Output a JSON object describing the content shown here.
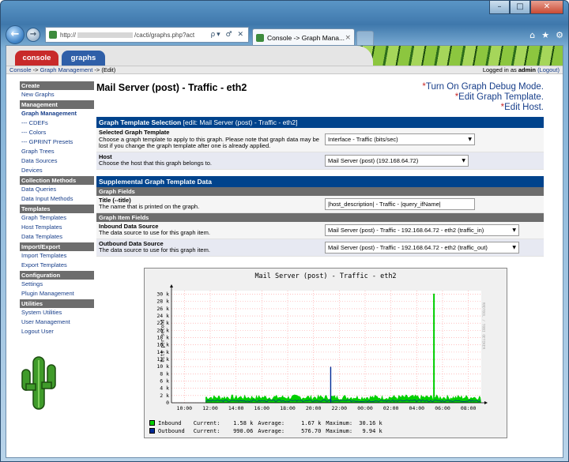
{
  "window": {
    "controls": [
      "–",
      "□",
      "✕"
    ]
  },
  "browser": {
    "address_prefix": "http://",
    "address_suffix": "/cacti/graphs.php?act",
    "address_tools": "ρ▾ ♂ ✕",
    "tab_title": "Console -> Graph Mana...",
    "tab_close": "×",
    "icons": [
      "⌂",
      "★",
      "⚙"
    ]
  },
  "header": {
    "tabs": {
      "console": "console",
      "graphs": "graphs"
    }
  },
  "breadcrumb": {
    "console": "Console",
    "sep1": " -> ",
    "graph_management": "Graph Management",
    "sep2": " -> ",
    "current": "(Edit)",
    "login_prefix": "Logged in as ",
    "user": "admin",
    "logout": "(Logout)"
  },
  "sidebar": {
    "sections": [
      {
        "head": "Create",
        "items": [
          {
            "label": "New Graphs"
          }
        ]
      },
      {
        "head": "Management",
        "items": [
          {
            "label": "Graph Management",
            "active": true
          },
          {
            "label": "--- CDEFs"
          },
          {
            "label": "--- Colors"
          },
          {
            "label": "--- GPRINT Presets"
          },
          {
            "label": "Graph Trees"
          },
          {
            "label": "Data Sources"
          },
          {
            "label": "Devices"
          }
        ]
      },
      {
        "head": "Collection Methods",
        "items": [
          {
            "label": "Data Queries"
          },
          {
            "label": "Data Input Methods"
          }
        ]
      },
      {
        "head": "Templates",
        "items": [
          {
            "label": "Graph Templates"
          },
          {
            "label": "Host Templates"
          },
          {
            "label": "Data Templates"
          }
        ]
      },
      {
        "head": "Import/Export",
        "items": [
          {
            "label": "Import Templates"
          },
          {
            "label": "Export Templates"
          }
        ]
      },
      {
        "head": "Configuration",
        "items": [
          {
            "label": "Settings"
          },
          {
            "label": "Plugin Management"
          }
        ]
      },
      {
        "head": "Utilities",
        "items": [
          {
            "label": "System Utilities"
          },
          {
            "label": "User Management"
          },
          {
            "label": "Logout User"
          }
        ]
      }
    ]
  },
  "main": {
    "title": "Mail Server (post) - Traffic - eth2",
    "actions": {
      "star": "*",
      "debug": "Turn On Graph Debug Mode.",
      "edit_template": "Edit Graph Template.",
      "edit_host": "Edit Host."
    },
    "selection": {
      "head": "Graph Template Selection",
      "head_edit": "[edit: Mail Server (post) - Traffic - eth2]",
      "template_label": "Selected Graph Template",
      "template_desc": "Choose a graph template to apply to this graph. Please note that graph data may be lost if you change the graph template after one is already applied.",
      "template_value": "Interface - Traffic (bits/sec)",
      "host_label": "Host",
      "host_desc": "Choose the host that this graph belongs to.",
      "host_value": "Mail Server (post) (192.168.64.72)"
    },
    "supplemental": {
      "head": "Supplemental Graph Template Data",
      "fields_head": "Graph Fields",
      "title_label": "Title (--title)",
      "title_desc": "The name that is printed on the graph.",
      "title_value": "|host_description| - Traffic - |query_ifName|",
      "item_fields_head": "Graph Item Fields",
      "inbound_label": "Inbound Data Source",
      "inbound_desc": "The data source to use for this graph item.",
      "inbound_value": "Mail Server (post) - Traffic - 192.168.64.72 - eth2 (traffic_in)",
      "outbound_label": "Outbound Data Source",
      "outbound_desc": "The data source to use for this graph item.",
      "outbound_value": "Mail Server (post) - Traffic - 192.168.64.72 - eth2 (traffic_out)"
    }
  },
  "graph": {
    "ylabel": "bits per second",
    "credit": "RRDTOOL / TOBI OETIKER",
    "legend": [
      {
        "name": "Inbound",
        "color": "#00cf00",
        "current_label": "Current:",
        "current": "1.58 k",
        "average_label": "Average:",
        "average": "1.67 k",
        "maximum_label": "Maximum:",
        "maximum": "30.16 k"
      },
      {
        "name": "Outbound",
        "color": "#002a97",
        "current_label": "Current:",
        "current": "990.06",
        "average_label": "Average:",
        "average": "576.70",
        "maximum_label": "Maximum:",
        "maximum": "9.94 k"
      }
    ]
  },
  "chart_data": {
    "type": "area",
    "title": "Mail Server (post) - Traffic - eth2",
    "ylabel": "bits per second",
    "x": [
      "10:00",
      "12:00",
      "14:00",
      "16:00",
      "18:00",
      "20:00",
      "22:00",
      "00:00",
      "02:00",
      "04:00",
      "06:00",
      "08:00"
    ],
    "y_ticks": [
      "0",
      "2 k",
      "4 k",
      "6 k",
      "8 k",
      "10 k",
      "12 k",
      "14 k",
      "16 k",
      "18 k",
      "20 k",
      "22 k",
      "24 k",
      "26 k",
      "28 k",
      "30 k"
    ],
    "ylim": [
      0,
      31000
    ],
    "grid": true,
    "series": [
      {
        "name": "Inbound",
        "color": "#00cf00",
        "baseline": 1600,
        "spikes": [
          {
            "x": "05:20",
            "value": 30160
          }
        ]
      },
      {
        "name": "Outbound",
        "color": "#002a97",
        "baseline": 580,
        "spikes": [
          {
            "x": "21:20",
            "value": 9940
          }
        ]
      }
    ]
  }
}
